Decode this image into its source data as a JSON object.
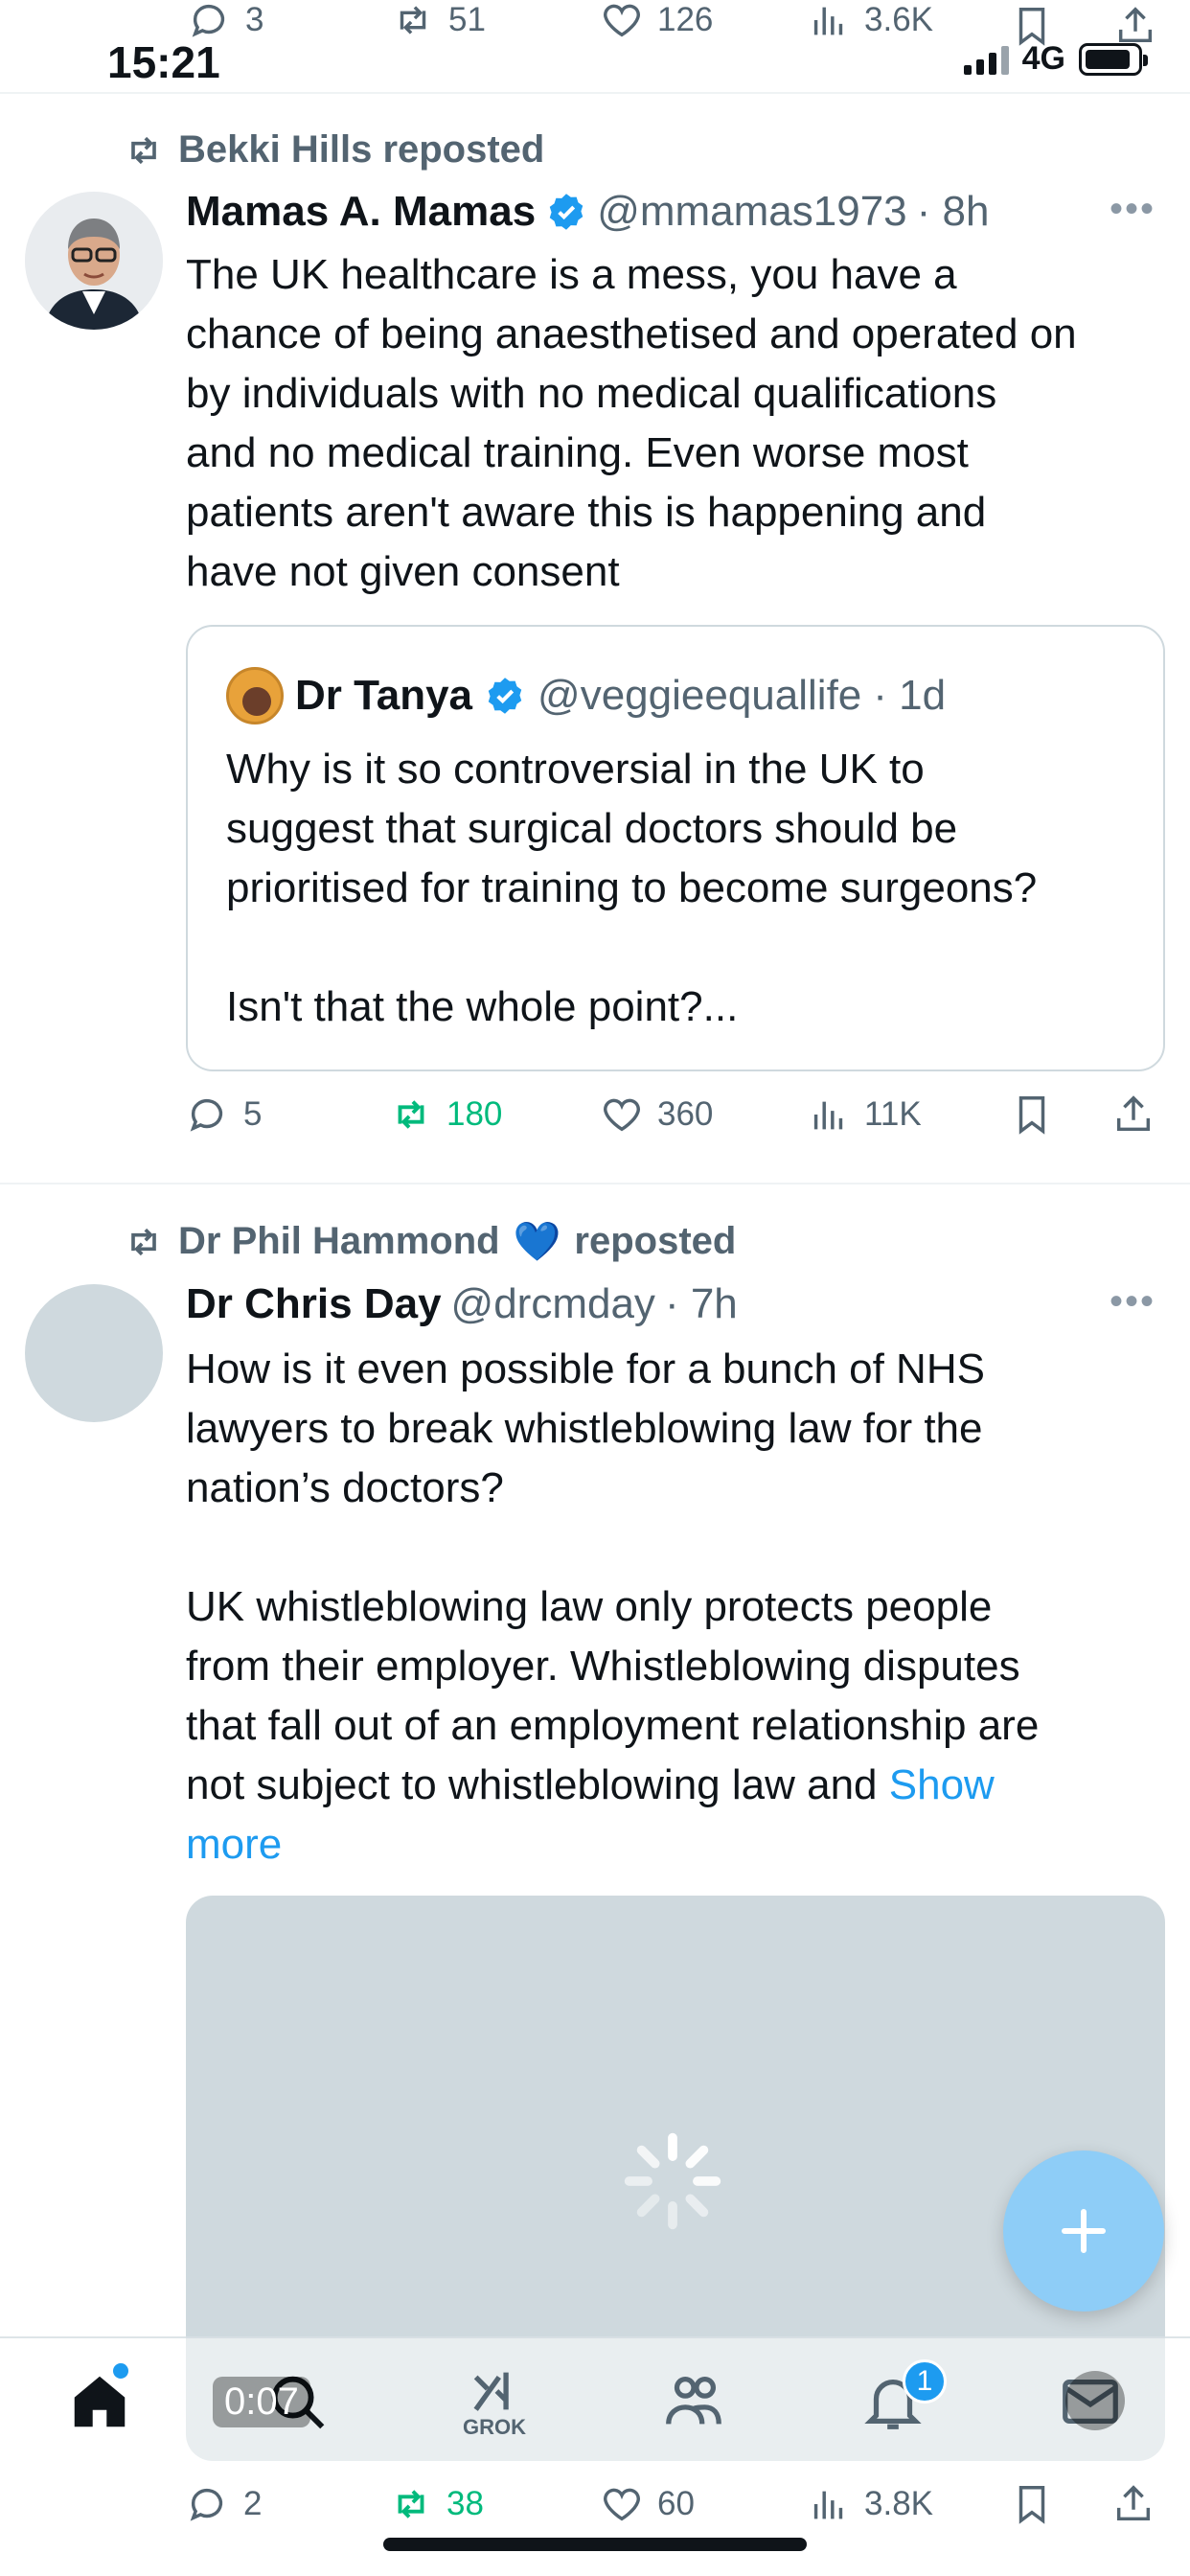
{
  "top_actions": {
    "replies": "3",
    "reposts": "51",
    "likes": "126",
    "views": "3.6K"
  },
  "status_bar": {
    "time": "15:21",
    "network": "4G"
  },
  "tweet1": {
    "repost_by": "Bekki Hills reposted",
    "name": "Mamas A. Mamas",
    "handle": "@mmamas1973",
    "time": "· 8h",
    "text": "The UK healthcare is a mess, you have a\nchance of being anaesthetised and operated on\nby individuals with no medical qualifications\nand no medical training. Even worse most\npatients aren't aware this is happening and\nhave not given consent",
    "quote": {
      "name": "Dr Tanya",
      "handle": "@veggieequallife",
      "time": "· 1d",
      "text": "Why is it so controversial in the UK to\nsuggest that surgical doctors should be\nprioritised for training to become surgeons?\n\nIsn't that the whole point?..."
    },
    "actions": {
      "replies": "5",
      "reposts": "180",
      "likes": "360",
      "views": "11K"
    }
  },
  "tweet2": {
    "repost_by": "Dr Phil Hammond",
    "repost_emoji": "💙",
    "repost_suffix": "reposted",
    "name": "Dr Chris Day",
    "handle": "@drcmday",
    "time": "· 7h",
    "text": "How is it even possible for a bunch of NHS\nlawyers to break whistleblowing law for the\nnation’s doctors?\n\nUK whistleblowing law only protects people\nfrom their employer. Whistleblowing disputes\nthat fall out of an employment relationship are\nnot subject to whistleblowing law and ",
    "show_more": "Show\nmore",
    "video_duration": "0:07",
    "actions": {
      "replies": "2",
      "reposts": "38",
      "likes": "60",
      "views": "3.8K"
    }
  },
  "bottom_nav": {
    "grok_label": "GROK",
    "notifications_badge": "1",
    "items": [
      "home-icon",
      "search-icon",
      "grok-icon",
      "communities-icon",
      "bell-icon",
      "mail-icon"
    ]
  },
  "colors": {
    "accent": "#1d9bf0",
    "repost_green": "#00ba7c",
    "muted": "#536471",
    "fab": "#8ecdf7",
    "media_placeholder": "#cfd9de"
  }
}
